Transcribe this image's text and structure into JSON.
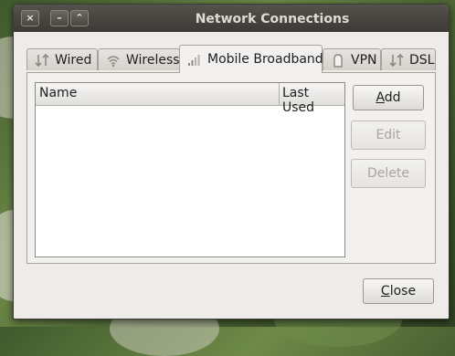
{
  "window": {
    "title": "Network Connections"
  },
  "titlebar_buttons": {
    "close": "×",
    "minimize": "–",
    "maximize": "⌃"
  },
  "tabs": [
    {
      "label": "Wired",
      "icon": "wired-icon"
    },
    {
      "label": "Wireless",
      "icon": "wireless-icon"
    },
    {
      "label": "Mobile Broadband",
      "icon": "mobile-broadband-icon",
      "active": true
    },
    {
      "label": "VPN",
      "icon": "vpn-lock-icon"
    },
    {
      "label": "DSL",
      "icon": "dsl-icon"
    }
  ],
  "list": {
    "columns": [
      "Name",
      "Last Used"
    ],
    "rows": []
  },
  "buttons": {
    "add": {
      "label": "Add",
      "mnemonic": "A",
      "rest": "dd"
    },
    "edit": {
      "label": "Edit"
    },
    "delete": {
      "label": "Delete"
    },
    "close": {
      "label": "Close",
      "mnemonic": "C",
      "rest": "lose"
    }
  },
  "colors": {
    "titlebar": "#3b3a36",
    "window": "#edeceb",
    "disabled_text": "#a8a59e"
  }
}
